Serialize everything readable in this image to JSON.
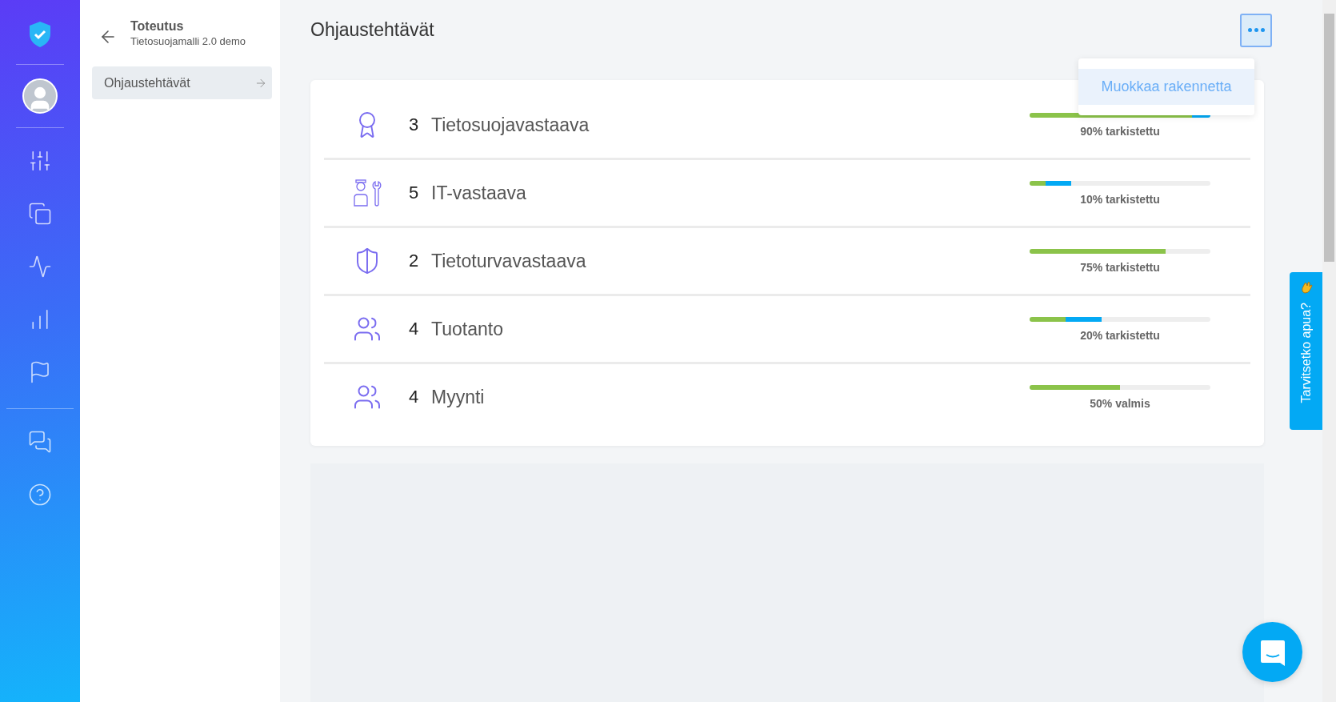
{
  "nav": {
    "title": "Toteutus",
    "subtitle": "Tietosuojamalli 2.0 demo",
    "items": [
      {
        "label": "Ohjaustehtävät",
        "selected": true
      }
    ]
  },
  "page": {
    "title": "Ohjaustehtävät"
  },
  "menu": {
    "open": true,
    "items": [
      {
        "label": "Muokkaa rakennetta",
        "hovered": true
      }
    ]
  },
  "rows": [
    {
      "kind": "award",
      "count": "3",
      "name": "Tietosuojavastaava",
      "segments": [
        {
          "color": "#8bc34a",
          "level": 0.9
        },
        {
          "color": "#03a9f4",
          "level": 0.1
        }
      ],
      "status": "90% tarkistettu"
    },
    {
      "kind": "worker",
      "count": "5",
      "name": "IT-vastaava",
      "segments": [
        {
          "color": "#8bc34a",
          "level": 0.09
        },
        {
          "color": "#03a9f4",
          "level": 0.14
        }
      ],
      "status": "10% tarkistettu"
    },
    {
      "kind": "shield",
      "count": "2",
      "name": "Tietoturvavastaava",
      "segments": [
        {
          "color": "#8bc34a",
          "level": 0.75
        }
      ],
      "status": "75% tarkistettu"
    },
    {
      "kind": "group",
      "count": "4",
      "name": "Tuotanto",
      "segments": [
        {
          "color": "#8bc34a",
          "level": 0.2
        },
        {
          "color": "#03a9f4",
          "level": 0.2
        }
      ],
      "status": "20% tarkistettu"
    },
    {
      "kind": "group",
      "count": "4",
      "name": "Myynti",
      "segments": [
        {
          "color": "#8bc34a",
          "level": 0.5
        }
      ],
      "status": "50% valmis"
    }
  ],
  "help": {
    "label": "Tarvitsetko apua?"
  }
}
